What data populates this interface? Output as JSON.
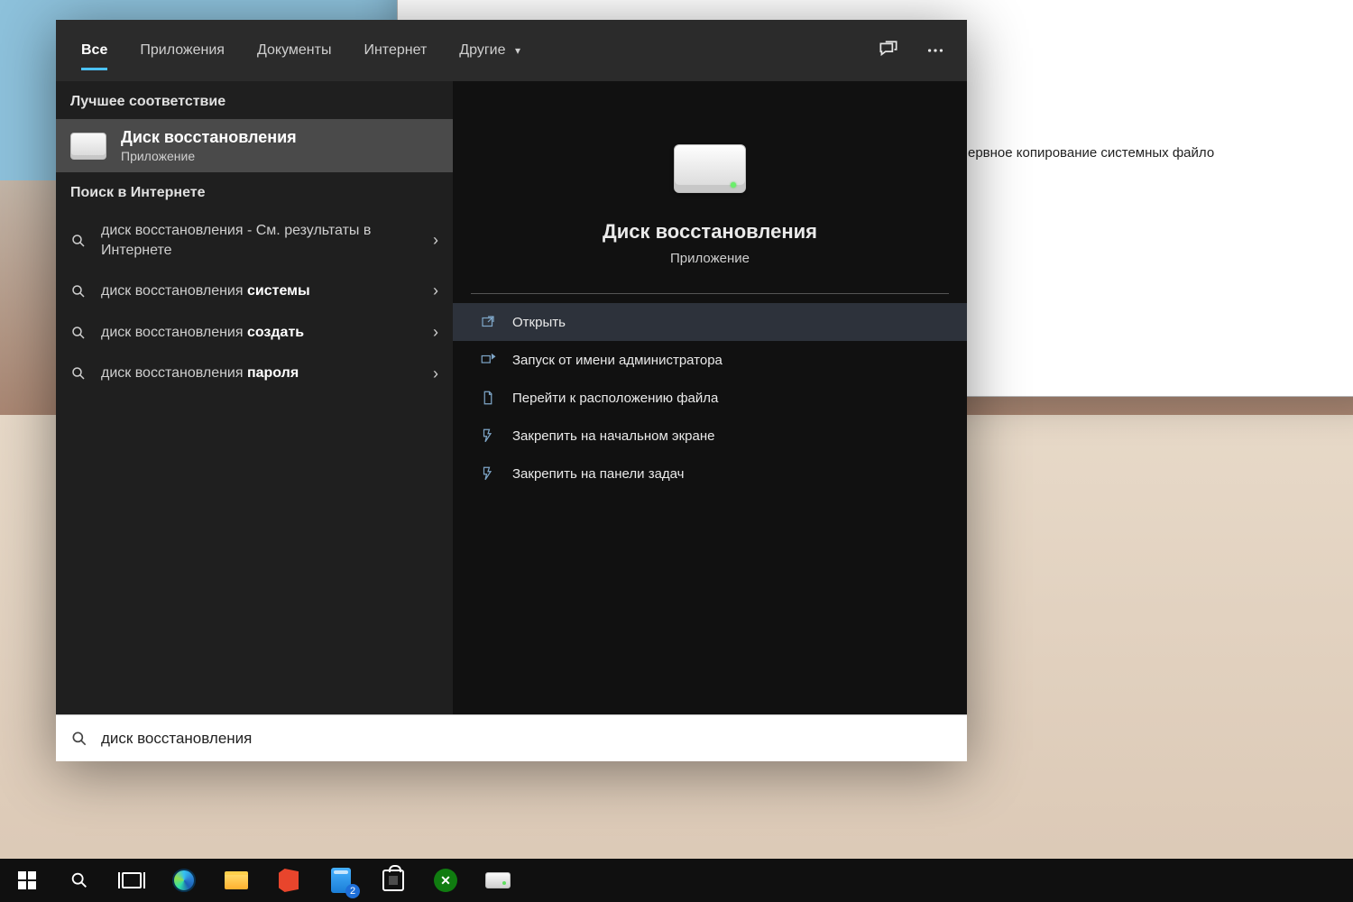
{
  "bg_window": {
    "visible_text": "ервное копирование системных файло"
  },
  "tabs": {
    "items": [
      "Все",
      "Приложения",
      "Документы",
      "Интернет",
      "Другие"
    ],
    "active_index": 0
  },
  "left": {
    "best_match_label": "Лучшее соответствие",
    "best_match": {
      "title": "Диск восстановления",
      "subtitle": "Приложение"
    },
    "web_label": "Поиск в Интернете",
    "web_items": [
      {
        "prefix": "диск восстановления",
        "bold": "",
        "suffix": " - См. результаты в Интернете"
      },
      {
        "prefix": "диск восстановления ",
        "bold": "системы",
        "suffix": ""
      },
      {
        "prefix": "диск восстановления ",
        "bold": "создать",
        "suffix": ""
      },
      {
        "prefix": "диск восстановления ",
        "bold": "пароля",
        "suffix": ""
      }
    ]
  },
  "right": {
    "title": "Диск восстановления",
    "subtitle": "Приложение",
    "actions": [
      "Открыть",
      "Запуск от имени администратора",
      "Перейти к расположению файла",
      "Закрепить на начальном экране",
      "Закрепить на панели задач"
    ],
    "selected_action_index": 0
  },
  "search_box": {
    "value": "диск восстановления"
  },
  "taskbar": {
    "films_badge": "2"
  }
}
